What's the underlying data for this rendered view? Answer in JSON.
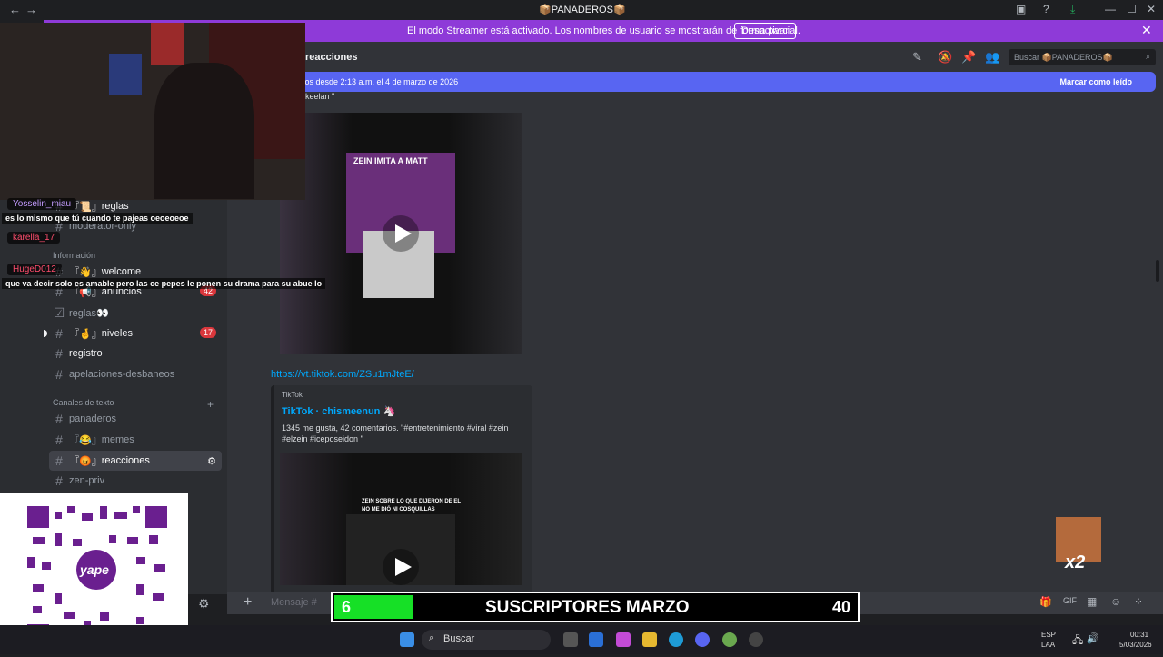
{
  "window": {
    "title": "📦PANADEROS📦",
    "back": "←",
    "forward": "→",
    "controls": [
      "—",
      "☐",
      "✕"
    ]
  },
  "banner": {
    "text": "El modo Streamer está activado. Los nombres de usuario se mostrarán de forma parcial.",
    "button": "Desactivar",
    "close": "✕"
  },
  "sidebar": {
    "channels_top": [
      {
        "label": "reglas",
        "prefix": "『📜』"
      },
      {
        "label": "moderator-only",
        "prefix": ""
      }
    ],
    "category_info": "Información",
    "info_channels": [
      {
        "label": "welcome",
        "prefix": "『👋』"
      },
      {
        "label": "anuncios",
        "prefix": "『📢』",
        "badge": "42"
      },
      {
        "label": "reglas👀",
        "prefix": ""
      },
      {
        "label": "niveles",
        "prefix": "『🤞』",
        "badge": "17"
      },
      {
        "label": "registro",
        "prefix": ""
      },
      {
        "label": "apelaciones-desbaneos",
        "prefix": ""
      }
    ],
    "category_text": "Canales de texto",
    "text_channels": [
      {
        "label": "panaderos",
        "prefix": ""
      },
      {
        "label": "memes",
        "prefix": "『😂』"
      },
      {
        "label": "reacciones",
        "prefix": "『😡』"
      },
      {
        "label": "zen-priv",
        "prefix": ""
      }
    ]
  },
  "main": {
    "channel_title": "reacciones",
    "search_placeholder": "Buscar 📦PANADEROS📦",
    "new_messages": "vos desde 2:13 a.m. el 4 de marzo de 2026",
    "mark_read": "Marcar como leído",
    "prev_embed_tail": "keelan \"",
    "video1_caption": "ZEIN IMITA A MATT",
    "link": "https://vt.tiktok.com/ZSu1mJteE/",
    "embed": {
      "provider": "TikTok",
      "title": "TikTok · chismeenun 🦄",
      "description": "1345 me gusta, 42 comentarios. \"#entretenimiento #viral #zein #elzein #iceposeidon \""
    },
    "video2_caption": "ZEIN SOBRE LO QUE DIJERON DE EL NO ME DIÓ NI COSQUILLAS",
    "message_placeholder": "Mensaje #"
  },
  "stream_overlay": {
    "chat": [
      {
        "user": "Yosselin_miau",
        "message": "es lo mismo que tú cuando te pajeas oeoeoeoe"
      },
      {
        "user": "karella_17",
        "message": ""
      },
      {
        "user": "HugeD012",
        "message": "que va decir solo es amable pero las ce pepes le ponen su drama para su abue lo"
      }
    ],
    "subs_current": "6",
    "subs_title": "SUSCRIPTORES MARZO",
    "subs_goal": "40",
    "subs_progress": 0.15,
    "multiplier": "x2",
    "qr_brand": "yape"
  },
  "taskbar": {
    "search": "Buscar",
    "lang": "ESP",
    "lang2": "LAA",
    "time": "00:31",
    "date": "5/03/2026"
  },
  "colors": {
    "banner": "#8e3ad8",
    "new_bar": "#5865f2",
    "link": "#00a8fc",
    "subs_fill": "#16e026"
  }
}
